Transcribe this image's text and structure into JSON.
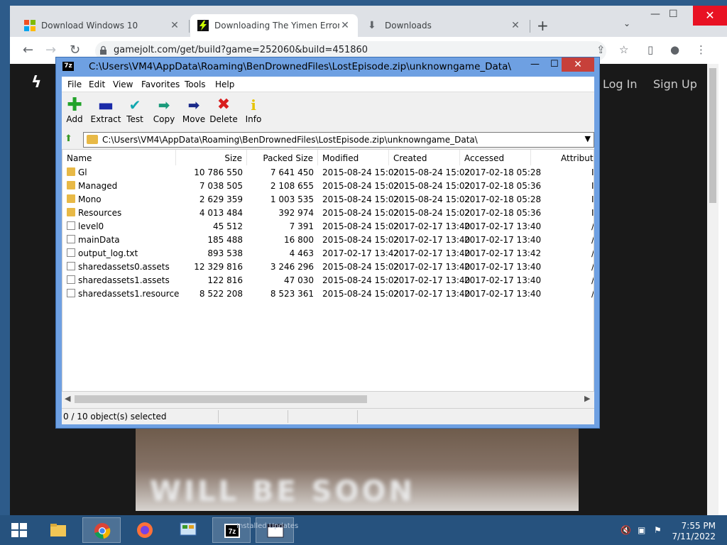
{
  "browser": {
    "tabs": [
      {
        "title": "Download Windows 10",
        "icon": "windows-logo-icon"
      },
      {
        "title": "Downloading The Yimen Error Se",
        "icon": "gamejolt-icon"
      },
      {
        "title": "Downloads",
        "icon": "download-icon"
      }
    ],
    "url": "gamejolt.com/get/build?game=252060&build=451860"
  },
  "page": {
    "login": "Log In",
    "signup": "Sign Up",
    "caption": "WILL BE SOON"
  },
  "zip": {
    "title": "C:\\Users\\VM4\\AppData\\Roaming\\BenDrownedFiles\\LostEpisode.zip\\unknowngame_Data\\",
    "menu": [
      "File",
      "Edit",
      "View",
      "Favorites",
      "Tools",
      "Help"
    ],
    "toolbar": [
      "Add",
      "Extract",
      "Test",
      "Copy",
      "Move",
      "Delete",
      "Info"
    ],
    "address": "C:\\Users\\VM4\\AppData\\Roaming\\BenDrownedFiles\\LostEpisode.zip\\unknowngame_Data\\",
    "columns": [
      "Name",
      "Size",
      "Packed Size",
      "Modified",
      "Created",
      "Accessed",
      "Attribute"
    ],
    "rows": [
      {
        "name": "Gl",
        "type": "folder",
        "size": "10 786 550",
        "packed": "7 641 450",
        "modified": "2015-08-24 15:02",
        "created": "2015-08-24 15:02",
        "accessed": "2017-02-18 05:28",
        "attr": "I"
      },
      {
        "name": "Managed",
        "type": "folder",
        "size": "7 038 505",
        "packed": "2 108 655",
        "modified": "2015-08-24 15:02",
        "created": "2015-08-24 15:02",
        "accessed": "2017-02-18 05:36",
        "attr": "I"
      },
      {
        "name": "Mono",
        "type": "folder",
        "size": "2 629 359",
        "packed": "1 003 535",
        "modified": "2015-08-24 15:02",
        "created": "2015-08-24 15:02",
        "accessed": "2017-02-18 05:28",
        "attr": "I"
      },
      {
        "name": "Resources",
        "type": "folder",
        "size": "4 013 484",
        "packed": "392 974",
        "modified": "2015-08-24 15:02",
        "created": "2015-08-24 15:02",
        "accessed": "2017-02-18 05:36",
        "attr": "I"
      },
      {
        "name": "level0",
        "type": "file",
        "size": "45 512",
        "packed": "7 391",
        "modified": "2015-08-24 15:02",
        "created": "2017-02-17 13:40",
        "accessed": "2017-02-17 13:40",
        "attr": "/"
      },
      {
        "name": "mainData",
        "type": "file",
        "size": "185 488",
        "packed": "16 800",
        "modified": "2015-08-24 15:02",
        "created": "2017-02-17 13:40",
        "accessed": "2017-02-17 13:40",
        "attr": "/"
      },
      {
        "name": "output_log.txt",
        "type": "file",
        "size": "893 538",
        "packed": "4 463",
        "modified": "2017-02-17 13:42",
        "created": "2017-02-17 13:40",
        "accessed": "2017-02-17 13:42",
        "attr": "/"
      },
      {
        "name": "sharedassets0.assets",
        "type": "file",
        "size": "12 329 816",
        "packed": "3 246 296",
        "modified": "2015-08-24 15:02",
        "created": "2017-02-17 13:40",
        "accessed": "2017-02-17 13:40",
        "attr": "/"
      },
      {
        "name": "sharedassets1.assets",
        "type": "file",
        "size": "122 816",
        "packed": "47 030",
        "modified": "2015-08-24 15:02",
        "created": "2017-02-17 13:40",
        "accessed": "2017-02-17 13:40",
        "attr": "/"
      },
      {
        "name": "sharedassets1.resource",
        "type": "file",
        "size": "8 522 208",
        "packed": "8 523 361",
        "modified": "2015-08-24 15:02",
        "created": "2017-02-17 13:40",
        "accessed": "2017-02-17 13:40",
        "attr": "/"
      }
    ],
    "status": "0 / 10 object(s) selected"
  },
  "taskbar": {
    "time": "7:55 PM",
    "date": "7/11/2022",
    "faded": "Installed Updates"
  }
}
